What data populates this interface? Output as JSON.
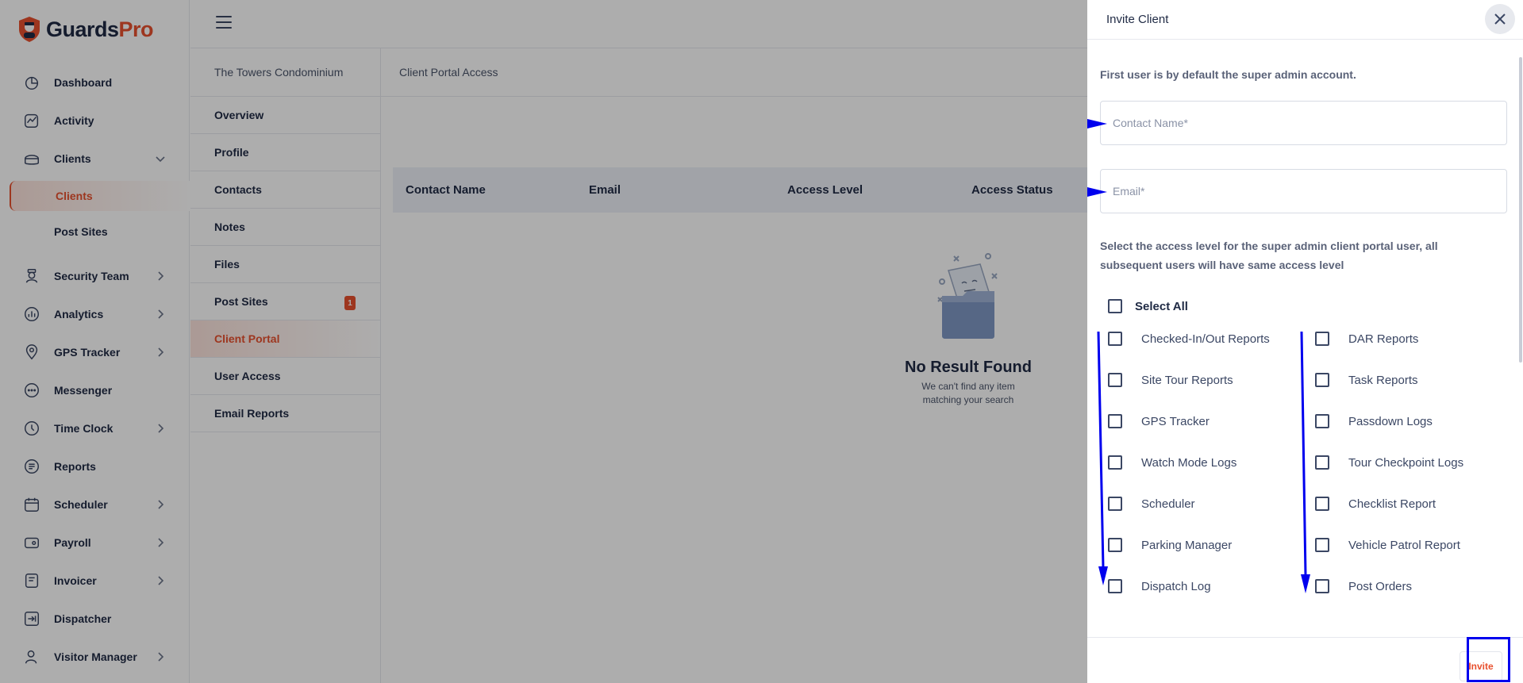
{
  "app": {
    "brand_main": "Guards",
    "brand_accent": "Pro",
    "accent_color": "#e8502e"
  },
  "sidebar": {
    "items": [
      {
        "label": "Dashboard",
        "icon": "dashboard-icon"
      },
      {
        "label": "Activity",
        "icon": "activity-icon"
      },
      {
        "label": "Clients",
        "icon": "clients-icon",
        "expanded": true,
        "children": [
          {
            "label": "Clients",
            "active": true
          },
          {
            "label": "Post Sites"
          }
        ]
      },
      {
        "label": "Security Team",
        "icon": "security-team-icon"
      },
      {
        "label": "Analytics",
        "icon": "analytics-icon"
      },
      {
        "label": "GPS Tracker",
        "icon": "gps-tracker-icon"
      },
      {
        "label": "Messenger",
        "icon": "messenger-icon"
      },
      {
        "label": "Time Clock",
        "icon": "time-clock-icon"
      },
      {
        "label": "Reports",
        "icon": "reports-icon"
      },
      {
        "label": "Scheduler",
        "icon": "scheduler-icon"
      },
      {
        "label": "Payroll",
        "icon": "payroll-icon"
      },
      {
        "label": "Invoicer",
        "icon": "invoicer-icon"
      },
      {
        "label": "Dispatcher",
        "icon": "dispatcher-icon"
      },
      {
        "label": "Visitor Manager",
        "icon": "visitor-manager-icon"
      }
    ]
  },
  "client_menu": {
    "title": "The Towers Condominium",
    "items": [
      {
        "label": "Overview"
      },
      {
        "label": "Profile"
      },
      {
        "label": "Contacts"
      },
      {
        "label": "Notes"
      },
      {
        "label": "Files"
      },
      {
        "label": "Post Sites",
        "badge": "1"
      },
      {
        "label": "Client Portal",
        "active": true
      },
      {
        "label": "User Access"
      },
      {
        "label": "Email Reports"
      }
    ]
  },
  "content": {
    "title": "Client Portal Access",
    "table_headers": [
      "Contact Name",
      "Email",
      "Access Level",
      "Access Status"
    ],
    "empty_title": "No Result Found",
    "empty_line1": "We can't find any item",
    "empty_line2": "matching your search"
  },
  "drawer": {
    "title": "Invite Client",
    "note": "First user is by default the super admin account.",
    "contact_placeholder": "Contact Name*",
    "email_placeholder": "Email*",
    "access_note_line1": "Select the access level for the super admin client portal user, all",
    "access_note_line2": "subsequent users will have same access level",
    "select_all": "Select All",
    "left_options": [
      "Checked-In/Out Reports",
      "Site Tour Reports",
      "GPS Tracker",
      "Watch Mode Logs",
      "Scheduler",
      "Parking Manager",
      "Dispatch Log"
    ],
    "right_options": [
      "DAR Reports",
      "Task Reports",
      "Passdown Logs",
      "Tour Checkpoint Logs",
      "Checklist Report",
      "Vehicle Patrol Report",
      "Post Orders"
    ],
    "invite_label": "Invite"
  },
  "annotation_color": "#0000ee"
}
